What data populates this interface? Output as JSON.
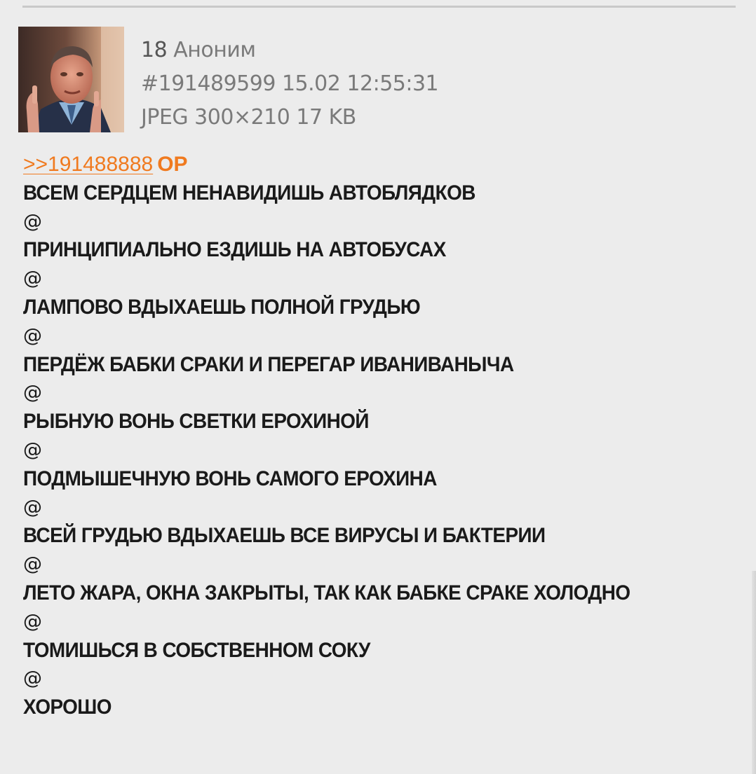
{
  "post": {
    "index": "18",
    "author": "Аноним",
    "post_number": "#191489599",
    "date": "15.02",
    "time": "12:55:31",
    "file_info": "JPEG 300×210 17 KB",
    "thumbnail_icon": "post-image-thumbnail",
    "reply_link": ">>191488888",
    "op_badge": "OP",
    "lines": [
      "ВСЕМ СЕРДЦЕМ НЕНАВИДИШЬ АВТОБЛЯДКОВ",
      "@",
      "ПРИНЦИПИАЛЬНО ЕЗДИШЬ НА АВТОБУСАХ",
      "@",
      "ЛАМПОВО ВДЫХАЕШЬ ПОЛНОЙ ГРУДЬЮ",
      "@",
      "ПЕРДЁЖ БАБКИ СРАКИ И ПЕРЕГАР ИВАНИВАНЫЧА",
      "@",
      "РЫБНУЮ ВОНЬ СВЕТКИ ЕРОХИНОЙ",
      "@",
      "ПОДМЫШЕЧНУЮ ВОНЬ САМОГО ЕРОХИНА",
      "@",
      "ВСЕЙ ГРУДЬЮ ВДЫХАЕШЬ ВСЕ ВИРУСЫ И БАКТЕРИИ",
      "@",
      "ЛЕТО ЖАРА, ОКНА ЗАКРЫТЫ, ТАК КАК БАБКЕ СРАКЕ ХОЛОДНО",
      "@",
      "ТОМИШЬСЯ В СОБСТВЕННОМ СОКУ",
      "@",
      "ХОРОШО"
    ]
  },
  "colors": {
    "background": "#ececec",
    "meta_text": "#7a7a7a",
    "body_text": "#1a1a1a",
    "link_accent": "#f07a1f",
    "divider": "#c9c9c9"
  }
}
